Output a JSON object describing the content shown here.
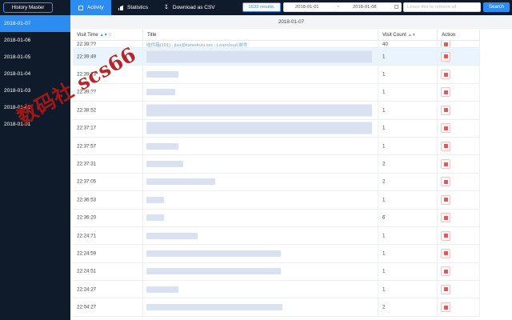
{
  "app": {
    "brand": "History Master"
  },
  "sidebar": {
    "dates": [
      "2018-01-07",
      "2018-01-06",
      "2018-01-05",
      "2018-01-04",
      "2018-01-03",
      "2018-01-02",
      "2018-01-01"
    ],
    "active_index": 0
  },
  "nav": {
    "tabs": [
      {
        "label": "Activity",
        "icon": "list-icon",
        "active": true
      },
      {
        "label": "Statistics",
        "icon": "bar-chart-icon",
        "active": false
      },
      {
        "label": "Download as CSV",
        "icon": "download-icon",
        "active": false
      }
    ]
  },
  "toolbar": {
    "results": "1633 results.",
    "date_start": "2018-01-01",
    "date_separator": "~",
    "date_end": "2018-01-08",
    "search_placeholder": "Leave this to retrieve all",
    "search_label": "Search"
  },
  "main": {
    "date_header": "2018-01-07",
    "columns": {
      "visit_time": "Visit Time",
      "title": "Title",
      "visit_count": "Visit Count",
      "action": "Action"
    },
    "partial_row": {
      "time": "22:39:??",
      "title": "收件箱(101) - jisu@kanedezu.xxx - Leancloud 邮件",
      "count": "40"
    },
    "rows": [
      {
        "time": "22:39:49",
        "count": "1",
        "highlighted": true
      },
      {
        "time": "22:39:23",
        "count": "1"
      },
      {
        "time": "22:39:??",
        "count": "1"
      },
      {
        "time": "22:38:52",
        "count": "1"
      },
      {
        "time": "22:37:17",
        "count": "1"
      },
      {
        "time": "22:37:57",
        "count": "1"
      },
      {
        "time": "22:37:31",
        "count": "2"
      },
      {
        "time": "22:37:05",
        "count": "2"
      },
      {
        "time": "22:36:53",
        "count": "1"
      },
      {
        "time": "22:36:20",
        "count": "6"
      },
      {
        "time": "22:24:71",
        "count": "1"
      },
      {
        "time": "22:24:59",
        "count": "1"
      },
      {
        "time": "22:24:51",
        "count": "1"
      },
      {
        "time": "22:24:27",
        "count": "1"
      },
      {
        "time": "22:04:27",
        "count": "2"
      }
    ]
  },
  "watermark": {
    "text": "数码社 scs66"
  },
  "colors": {
    "sidebar_bg": "#0f1b2b",
    "accent": "#2d8cf0",
    "row_highlight": "#eaf4fe",
    "delete_red": "#e05a5a",
    "watermark": "#b01616"
  }
}
